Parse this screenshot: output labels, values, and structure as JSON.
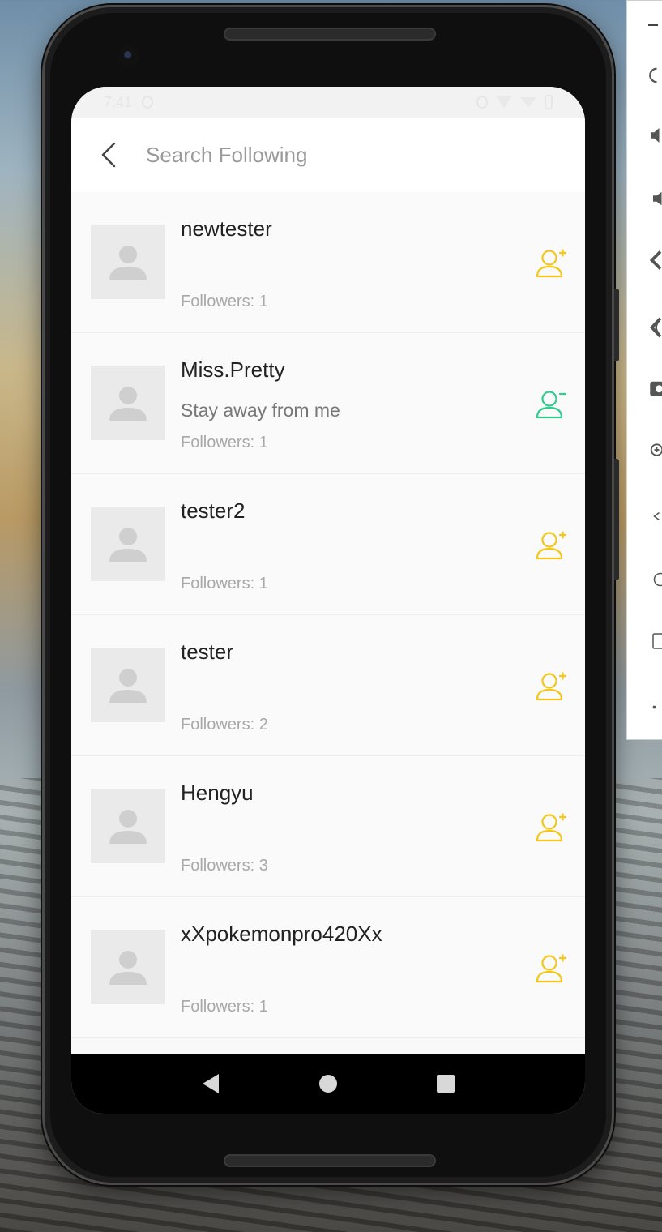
{
  "status_bar": {
    "time": "7:41"
  },
  "search": {
    "placeholder": "Search Following"
  },
  "users": [
    {
      "name": "newtester",
      "bio": "",
      "followers": "Followers: 1",
      "follow_state": "follow",
      "icon": "user-add-icon"
    },
    {
      "name": "Miss.Pretty",
      "bio": "Stay away from me",
      "followers": "Followers: 1",
      "follow_state": "following",
      "icon": "user-remove-icon"
    },
    {
      "name": "tester2",
      "bio": "",
      "followers": "Followers: 1",
      "follow_state": "follow",
      "icon": "user-add-icon"
    },
    {
      "name": "tester",
      "bio": "",
      "followers": "Followers: 2",
      "follow_state": "follow",
      "icon": "user-add-icon"
    },
    {
      "name": "Hengyu",
      "bio": "",
      "followers": "Followers: 3",
      "follow_state": "follow",
      "icon": "user-add-icon"
    },
    {
      "name": "xXpokemonpro420Xx",
      "bio": "",
      "followers": "Followers: 1",
      "follow_state": "follow",
      "icon": "user-add-icon"
    }
  ],
  "colors": {
    "follow_icon": "#f5c518",
    "following_icon": "#2ecc8f",
    "avatar_bg": "#eaeaea",
    "avatar_fg": "#cfcfcf"
  },
  "nav_bar": {
    "buttons": [
      "back-triangle-icon",
      "home-circle-icon",
      "recents-square-icon"
    ]
  },
  "emulator_toolbar": {
    "items": [
      "minimize-icon",
      "power-icon",
      "volume-up-icon",
      "volume-down-icon",
      "rotate-left-icon",
      "rotate-right-icon",
      "camera-icon",
      "zoom-icon",
      "back-icon",
      "home-icon",
      "overview-icon",
      "more-icon"
    ]
  }
}
